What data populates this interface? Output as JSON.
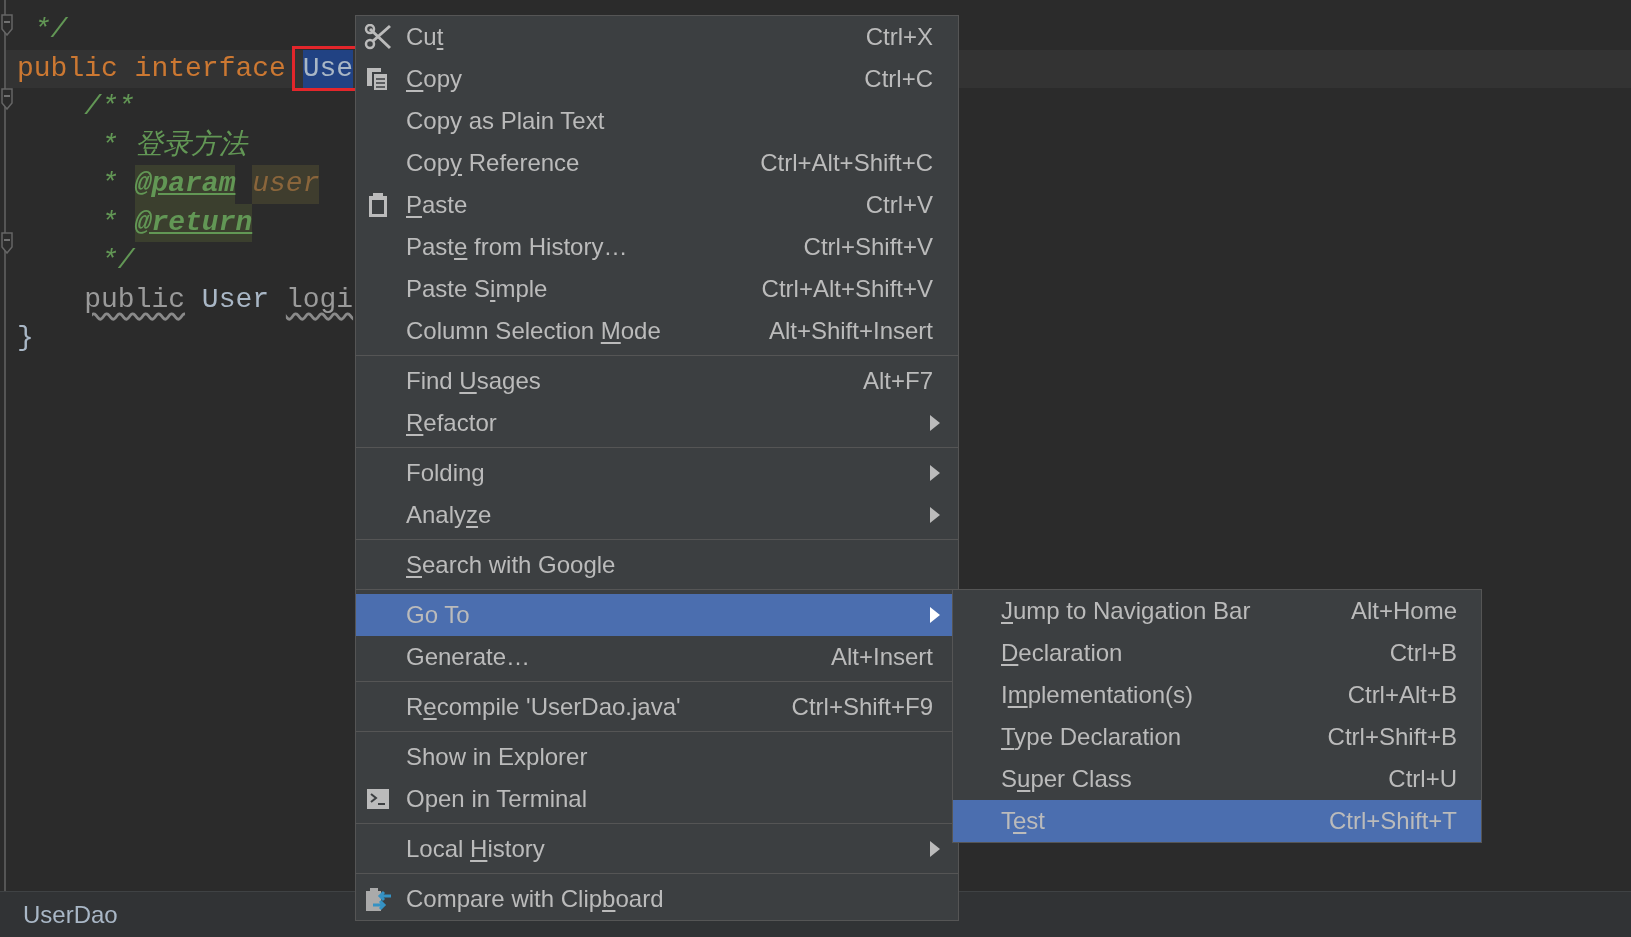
{
  "editor": {
    "lines": [
      {
        "current": false,
        "tokens": [
          {
            "text": " */",
            "kind": "comment"
          }
        ]
      },
      {
        "current": true,
        "tokens": [
          {
            "text": "public interface ",
            "kind": "keyword"
          },
          {
            "text": "Use",
            "kind": "selected",
            "annotated": true
          }
        ]
      },
      {
        "current": false,
        "tokens": [
          {
            "text": "    /**",
            "kind": "comment"
          }
        ]
      },
      {
        "current": false,
        "tokens": [
          {
            "text": "     * 登录方法",
            "kind": "comment"
          }
        ]
      },
      {
        "current": false,
        "tokens": [
          {
            "text": "     * ",
            "kind": "comment"
          },
          {
            "text": "@param",
            "kind": "tag"
          },
          {
            "text": " user",
            "kind": "param"
          }
        ]
      },
      {
        "current": false,
        "tokens": [
          {
            "text": "     * ",
            "kind": "comment"
          },
          {
            "text": "@return",
            "kind": "tag"
          }
        ]
      },
      {
        "current": false,
        "tokens": [
          {
            "text": "     */",
            "kind": "comment"
          }
        ]
      },
      {
        "current": false,
        "tokens": [
          {
            "text": "    public",
            "kind": "warning"
          },
          {
            "text": " User ",
            "kind": "plain"
          },
          {
            "text": "logi",
            "kind": "warning"
          }
        ]
      },
      {
        "current": false,
        "tokens": [
          {
            "text": "}",
            "kind": "plain"
          }
        ]
      }
    ]
  },
  "context_menu": {
    "groups": [
      [
        {
          "label": {
            "pre": "Cu",
            "key": "t"
          },
          "shortcut": "Ctrl+X",
          "selected": false
        },
        {
          "label": {
            "key": "C",
            "post": "opy"
          },
          "shortcut": "Ctrl+C",
          "selected": false
        },
        {
          "label": {
            "pre": "Copy as Plain Text"
          },
          "selected": false
        },
        {
          "label": {
            "pre": "Cop",
            "key": "y",
            "post": " Reference"
          },
          "shortcut": "Ctrl+Alt+Shift+C",
          "selected": false
        },
        {
          "label": {
            "key": "P",
            "post": "aste"
          },
          "shortcut": "Ctrl+V",
          "selected": false
        },
        {
          "label": {
            "pre": "Past",
            "key": "e",
            "post": " from History…"
          },
          "shortcut": "Ctrl+Shift+V",
          "selected": false
        },
        {
          "label": {
            "pre": "Paste S",
            "key": "i",
            "post": "mple"
          },
          "shortcut": "Ctrl+Alt+Shift+V",
          "selected": false
        },
        {
          "label": {
            "pre": "Column Selection ",
            "key": "M",
            "post": "ode"
          },
          "shortcut": "Alt+Shift+Insert",
          "selected": false
        }
      ],
      [
        {
          "label": {
            "pre": "Find ",
            "key": "U",
            "post": "sages"
          },
          "shortcut": "Alt+F7",
          "selected": false
        },
        {
          "label": {
            "key": "R",
            "post": "efactor"
          },
          "submenu": true,
          "selected": false
        }
      ],
      [
        {
          "label": {
            "pre": "Folding"
          },
          "submenu": true,
          "selected": false
        },
        {
          "label": {
            "pre": "Analy",
            "key": "z",
            "post": "e"
          },
          "submenu": true,
          "selected": false
        }
      ],
      [
        {
          "label": {
            "key": "S",
            "post": "earch with Google"
          },
          "selected": false
        }
      ],
      [
        {
          "label": {
            "pre": "Go To"
          },
          "submenu": true,
          "selected": true
        },
        {
          "label": {
            "pre": "Generate…"
          },
          "shortcut": "Alt+Insert",
          "selected": false
        }
      ],
      [
        {
          "label": {
            "pre": "R",
            "key": "e",
            "post": "compile 'UserDao.java'"
          },
          "shortcut": "Ctrl+Shift+F9",
          "selected": false
        }
      ],
      [
        {
          "label": {
            "pre": "Show in Explorer"
          },
          "selected": false
        },
        {
          "label": {
            "pre": "Open in Terminal"
          },
          "selected": false
        }
      ],
      [
        {
          "label": {
            "pre": "Local ",
            "key": "H",
            "post": "istory"
          },
          "submenu": true,
          "selected": false
        }
      ],
      [
        {
          "label": {
            "pre": "Compare with Clip",
            "key": "b",
            "post": "oard"
          },
          "selected": false
        }
      ]
    ]
  },
  "goto_submenu": {
    "items": [
      {
        "label": {
          "key": "J",
          "post": "ump to Navigation Bar"
        },
        "shortcut": "Alt+Home",
        "selected": false
      },
      {
        "label": {
          "key": "D",
          "post": "eclaration"
        },
        "shortcut": "Ctrl+B",
        "selected": false
      },
      {
        "label": {
          "pre": "I",
          "key": "m",
          "post": "plementation(s)"
        },
        "shortcut": "Ctrl+Alt+B",
        "selected": false
      },
      {
        "label": {
          "key": "T",
          "post": "ype Declaration"
        },
        "shortcut": "Ctrl+Shift+B",
        "selected": false
      },
      {
        "label": {
          "pre": "S",
          "key": "u",
          "post": "per Class"
        },
        "shortcut": "Ctrl+U",
        "selected": false
      },
      {
        "label": {
          "pre": "T",
          "key": "e",
          "post": "st"
        },
        "shortcut": "Ctrl+Shift+T",
        "selected": true
      }
    ]
  },
  "status_bar": {
    "breadcrumb": "UserDao"
  }
}
